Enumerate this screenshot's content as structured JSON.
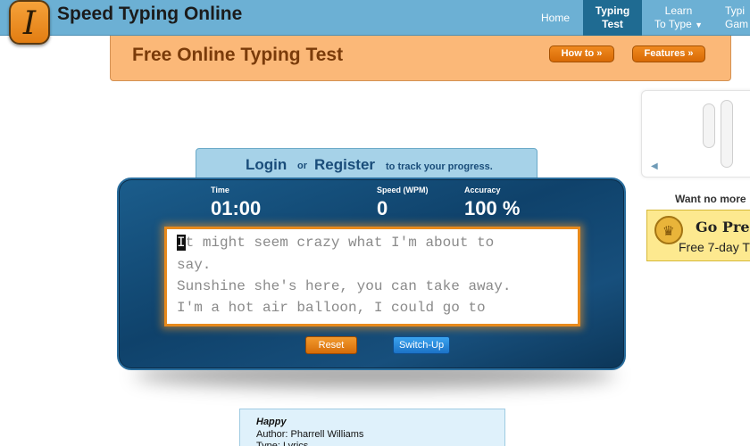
{
  "nav": {
    "site_title": "Speed Typing Online",
    "logo_letter": "I",
    "home": "Home",
    "typing_test_1": "Typing",
    "typing_test_2": "Test",
    "learn_1": "Learn",
    "learn_2": "To Type",
    "games_1": "Typi",
    "games_2": "Gam"
  },
  "banner": {
    "title": "Free Online Typing Test",
    "how_to": "How to »",
    "features": "Features »"
  },
  "login": {
    "login": "Login",
    "or": "or",
    "register": "Register",
    "note": "to track your progress."
  },
  "stats": {
    "time_label": "Time",
    "time_value": "01:00",
    "speed_label": "Speed (WPM)",
    "speed_value": "0",
    "accuracy_label": "Accuracy",
    "accuracy_value": "100 %"
  },
  "typing": {
    "cursor_char": "I",
    "line1_rest": "t might seem crazy what I'm about to",
    "line2": "say.",
    "line3": "Sunshine she's here, you can take away.",
    "line4": "I'm a hot air balloon, I could go to"
  },
  "buttons": {
    "reset": "Reset",
    "switch_up": "Switch-Up"
  },
  "ads": {
    "want_more": "Want no more",
    "premium_title": "Go Prem",
    "premium_sub": "Free 7-day T"
  },
  "song": {
    "title": "Happy",
    "author": "Author: Pharrell Williams",
    "type": "Type: Lyrics"
  },
  "colors": {
    "nav_bg": "#6cb0d4",
    "nav_active": "#1f6b92",
    "banner_bg": "#fbb878",
    "panel_bg": "#0f426b",
    "textbox_border": "#e88a1c"
  }
}
